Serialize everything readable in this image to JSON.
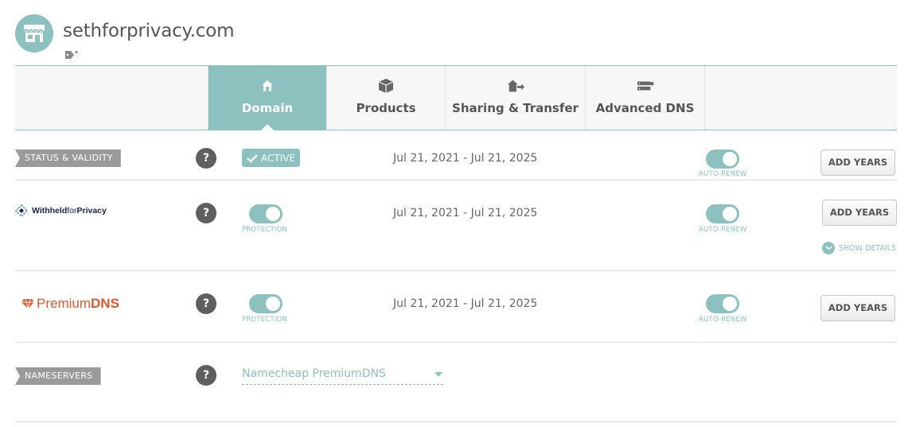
{
  "header": {
    "domain": "sethforprivacy.com",
    "avatar_icon": "store-icon",
    "tag_icon": "tag-add-icon"
  },
  "tabs": [
    {
      "label": "Domain",
      "icon": "home-icon",
      "active": true
    },
    {
      "label": "Products",
      "icon": "box-icon",
      "active": false
    },
    {
      "label": "Sharing & Transfer",
      "icon": "transfer-icon",
      "active": false
    },
    {
      "label": "Advanced DNS",
      "icon": "server-icon",
      "active": false
    }
  ],
  "status": {
    "label": "STATUS & VALIDITY",
    "help": "?",
    "badge": "ACTIVE",
    "dates": "Jul 21, 2021 - Jul 21, 2025",
    "toggle_caption": "AUTO-RENEW",
    "button": "ADD YEARS"
  },
  "privacy": {
    "logo_bold": "Withheld",
    "logo_light": "for",
    "logo_bold2": "Privacy",
    "help": "?",
    "protection_caption": "PROTECTION",
    "dates": "Jul 21, 2021 - Jul 21, 2025",
    "toggle_caption": "AUTO-RENEW",
    "button": "ADD YEARS",
    "show_details": "SHOW DETAILS"
  },
  "premium_dns": {
    "logo_light": "Premium",
    "logo_bold": "DNS",
    "help": "?",
    "protection_caption": "PROTECTION",
    "dates": "Jul 21, 2021 - Jul 21, 2025",
    "toggle_caption": "AUTO-RENEW",
    "button": "ADD YEARS"
  },
  "nameservers": {
    "label": "NAMESERVERS",
    "help": "?",
    "selected": "Namecheap PremiumDNS"
  },
  "colors": {
    "accent": "#8cc1bf",
    "label_bg": "#9a9a9a",
    "premium_dns": "#e4572e",
    "privacy_navy": "#1a1f4d"
  }
}
